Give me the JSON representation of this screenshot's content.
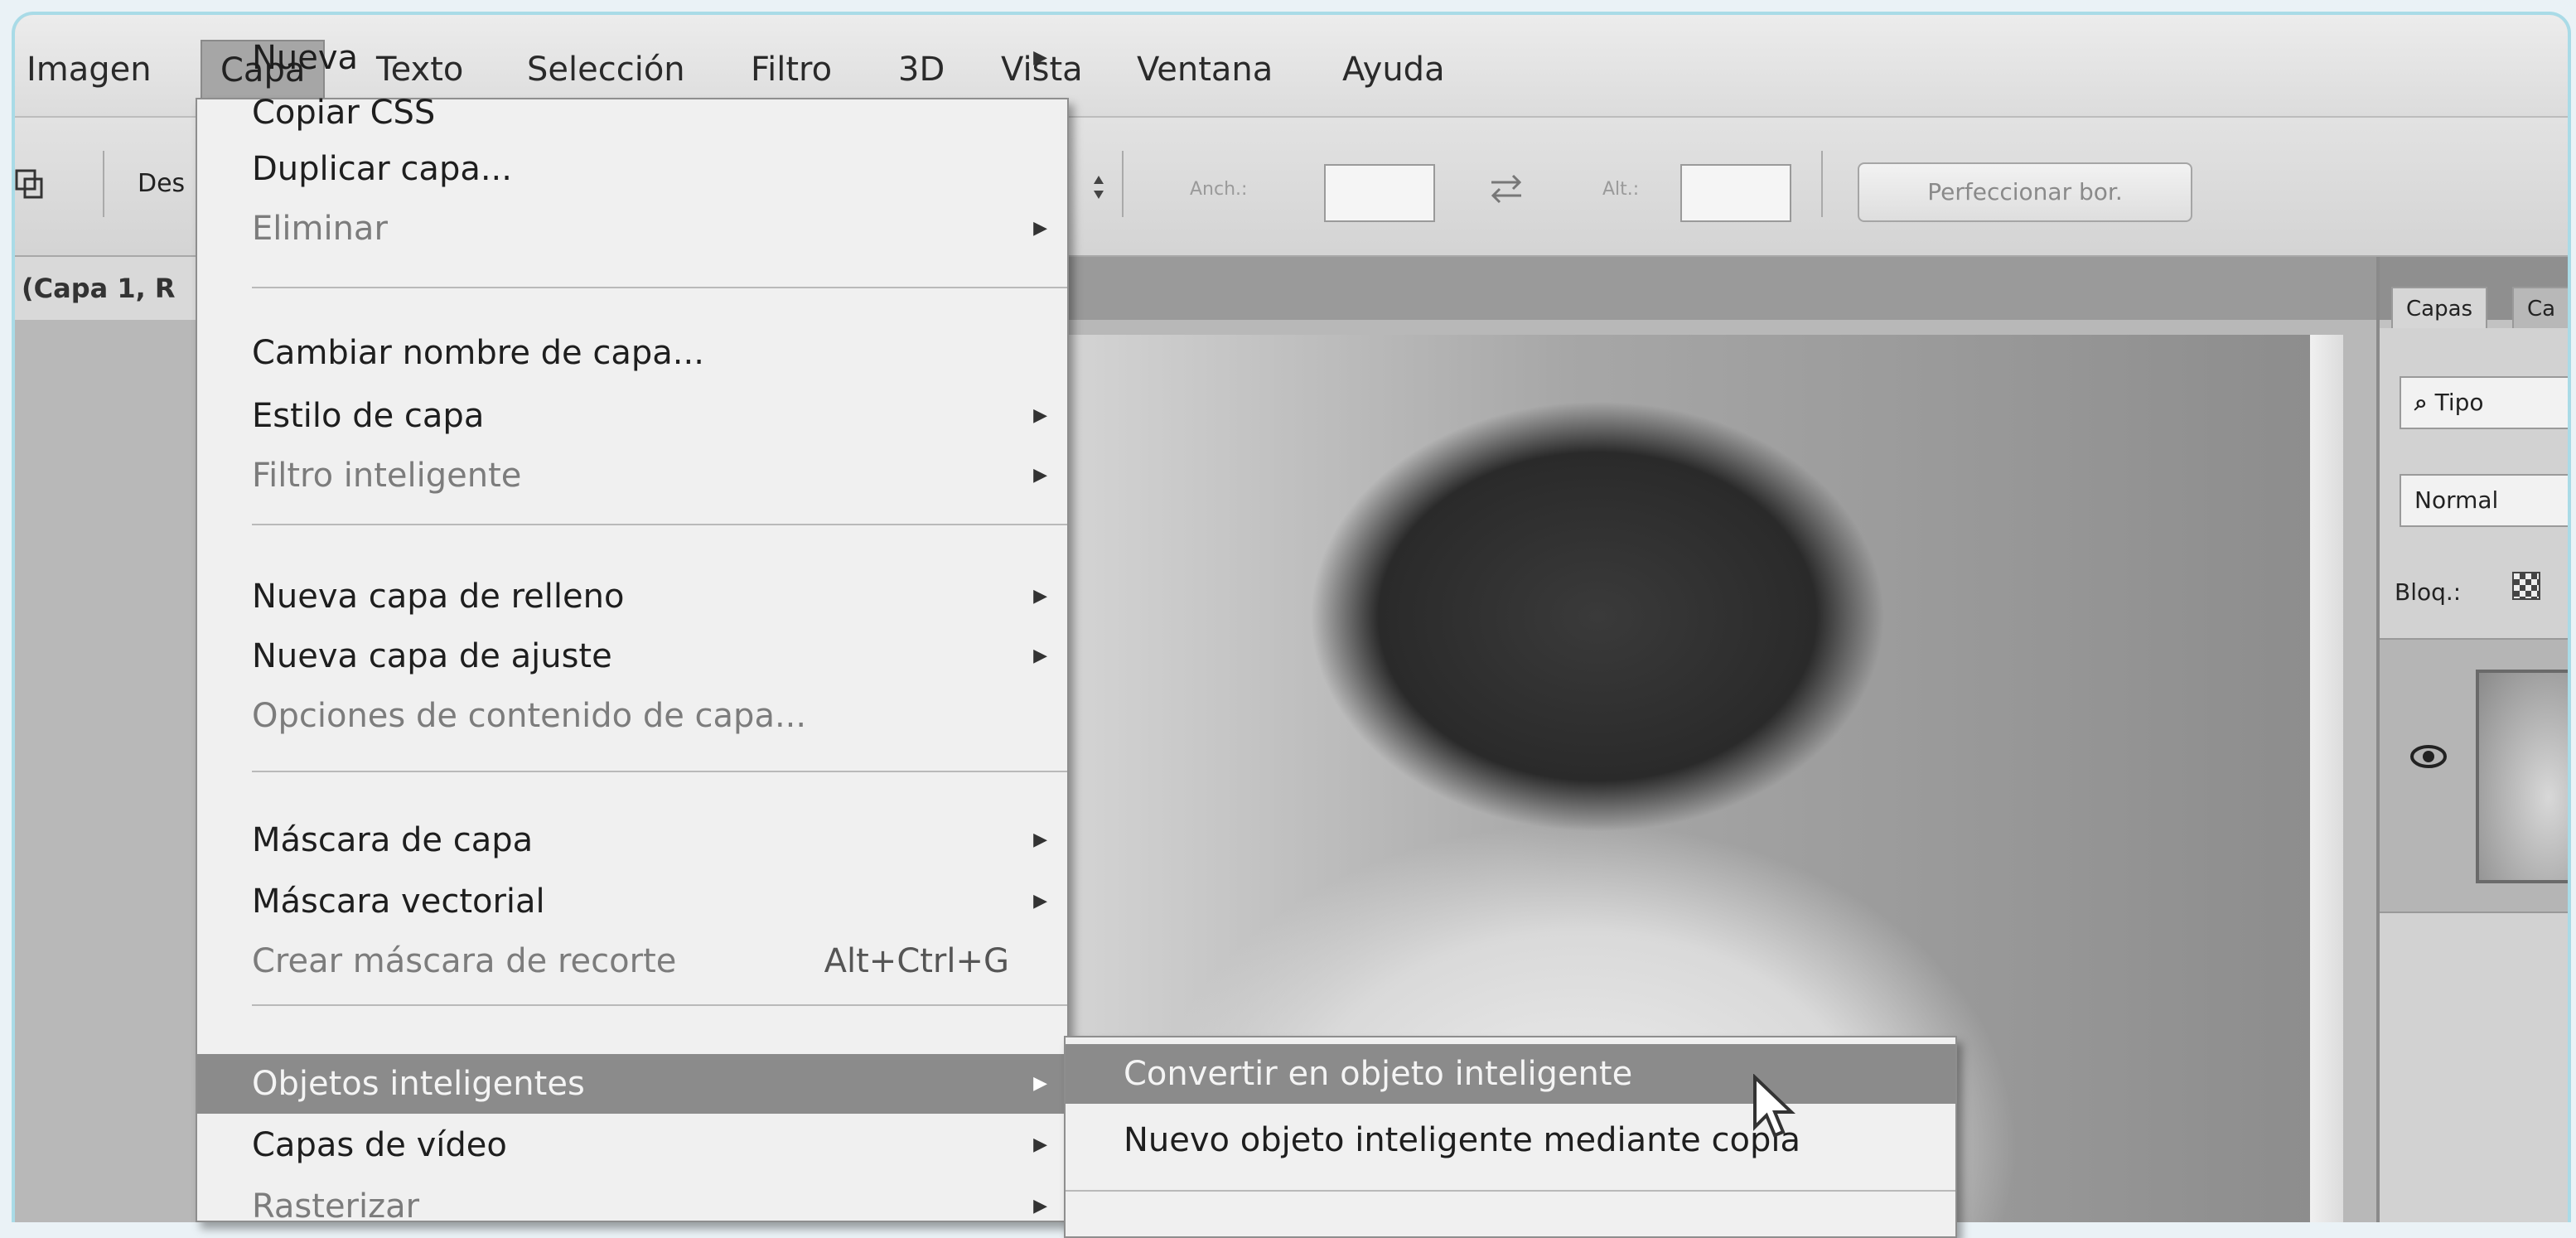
{
  "menubar": {
    "items": [
      "Imagen",
      "Capa",
      "Texto",
      "Selección",
      "Filtro",
      "3D",
      "Vista",
      "Ventana",
      "Ayuda"
    ],
    "active_index": 1
  },
  "options": {
    "mode_label": "Des",
    "width_label": "Anch.:",
    "height_label": "Alt.:",
    "refine_button": "Perfeccionar bor."
  },
  "document": {
    "tab_title": "(Capa 1, R"
  },
  "capa_menu": {
    "items": [
      {
        "label": "Nueva",
        "submenu": true,
        "disabled": false
      },
      {
        "label": "Copiar CSS",
        "submenu": false,
        "disabled": false
      },
      {
        "label": "Duplicar capa...",
        "submenu": false,
        "disabled": false
      },
      {
        "label": "Eliminar",
        "submenu": true,
        "disabled": true
      },
      {
        "label": "Cambiar nombre de capa...",
        "submenu": false,
        "disabled": false
      },
      {
        "label": "Estilo de capa",
        "submenu": true,
        "disabled": false
      },
      {
        "label": "Filtro inteligente",
        "submenu": true,
        "disabled": true
      },
      {
        "label": "Nueva capa de relleno",
        "submenu": true,
        "disabled": false
      },
      {
        "label": "Nueva capa de ajuste",
        "submenu": true,
        "disabled": false
      },
      {
        "label": "Opciones de contenido de capa...",
        "submenu": false,
        "disabled": true
      },
      {
        "label": "Máscara de capa",
        "submenu": true,
        "disabled": false
      },
      {
        "label": "Máscara vectorial",
        "submenu": true,
        "disabled": false
      },
      {
        "label": "Crear máscara de recorte",
        "submenu": false,
        "disabled": true,
        "shortcut": "Alt+Ctrl+G"
      },
      {
        "label": "Objetos inteligentes",
        "submenu": true,
        "disabled": false,
        "highlight": true
      },
      {
        "label": "Capas de vídeo",
        "submenu": true,
        "disabled": false
      },
      {
        "label": "Rasterizar",
        "submenu": true,
        "disabled": true
      }
    ]
  },
  "smart_objects_submenu": {
    "items": [
      {
        "label": "Convertir en objeto inteligente",
        "highlight": true
      },
      {
        "label": "Nuevo objeto inteligente mediante copia",
        "highlight": false
      }
    ]
  },
  "layers_panel": {
    "tabs": [
      "Capas",
      "Ca"
    ],
    "filter_label": "Tipo",
    "blend_mode": "Normal",
    "lock_label": "Bloq.:"
  },
  "icons": {
    "submenu_arrow": "triangle-right-icon",
    "filter": "search-icon",
    "visibility": "eye-icon",
    "lock": "checkerboard-lock-icon",
    "swap": "swap-arrows-icon",
    "cursor": "mouse-pointer-icon"
  },
  "colors": {
    "highlight": "#8b8b8b",
    "frame_border": "#a9dbe7",
    "menu_bg": "#f0f0f0"
  }
}
